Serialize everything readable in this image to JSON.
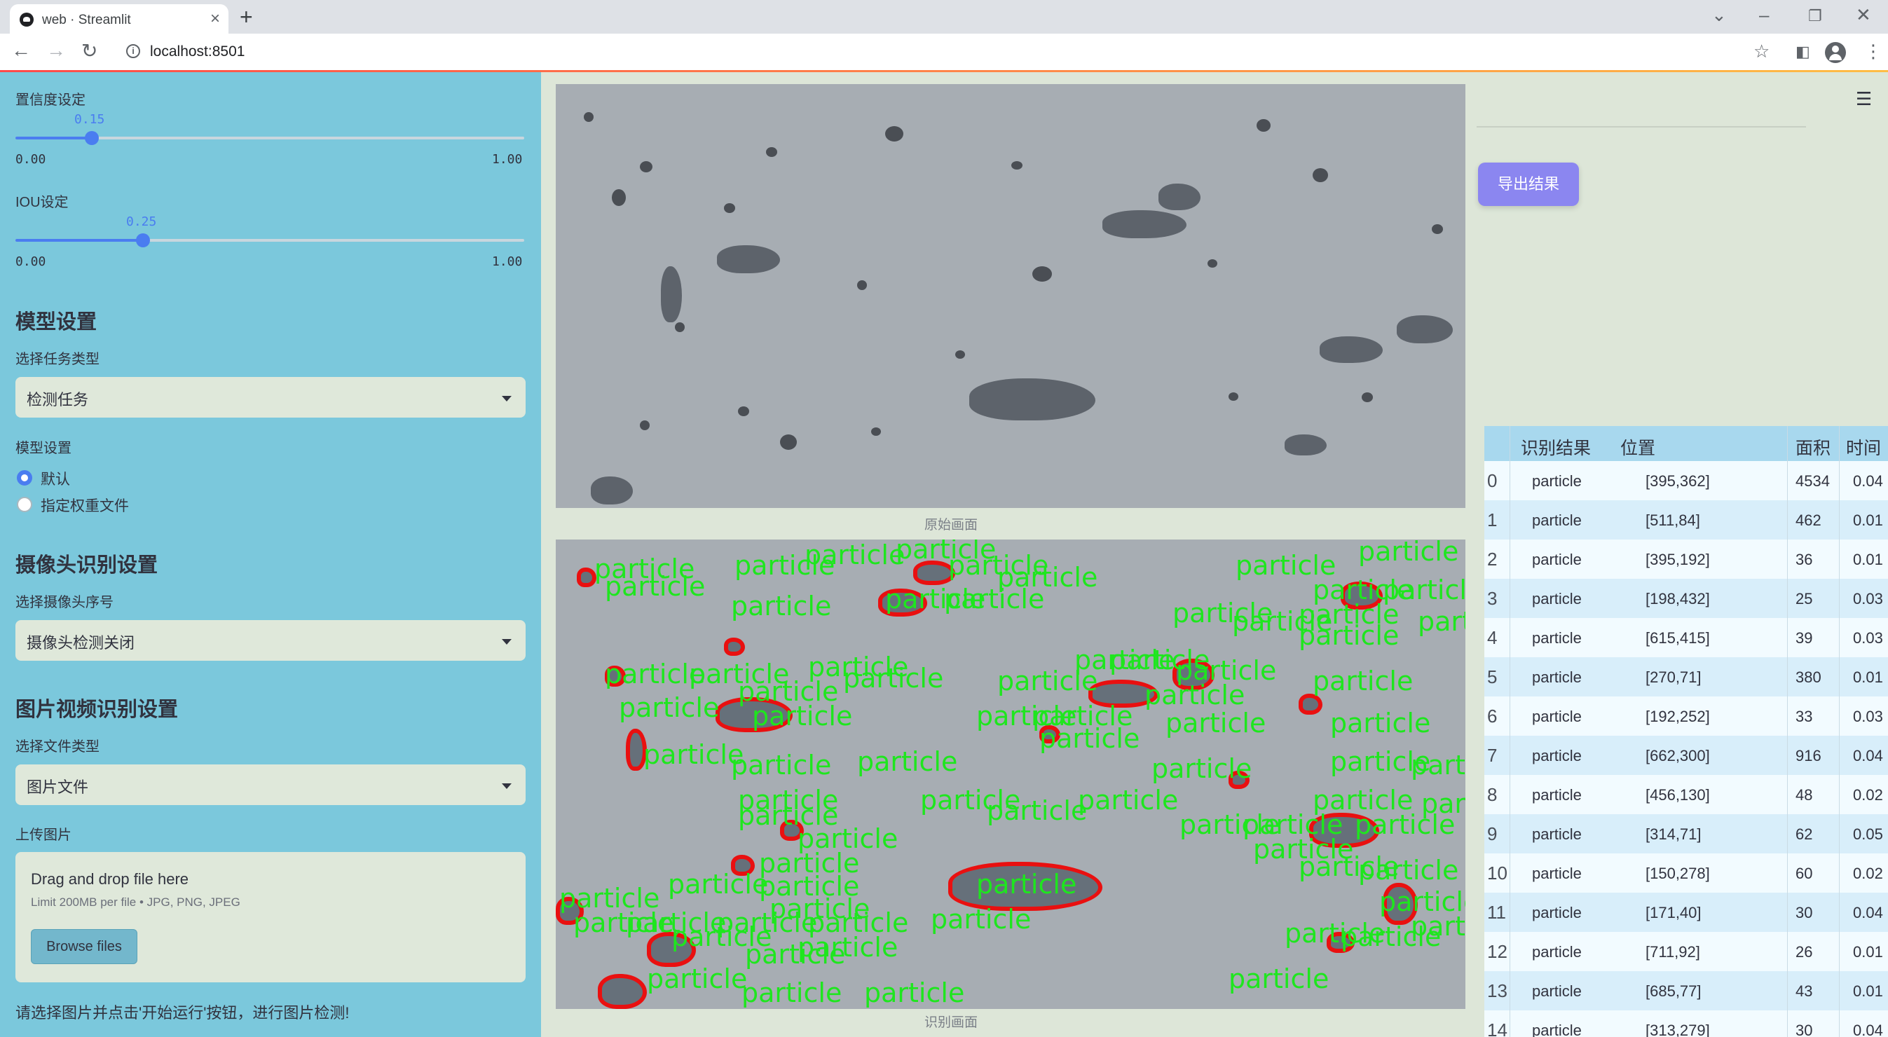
{
  "browser": {
    "tab_title": "web · Streamlit",
    "new_tab": "+",
    "url": "localhost:8501"
  },
  "sidebar": {
    "conf_label": "置信度设定",
    "conf_value": 0.15,
    "conf_value_text": "0.15",
    "conf_min": "0.00",
    "conf_max": "1.00",
    "iou_label": "IOU设定",
    "iou_value": 0.25,
    "iou_value_text": "0.25",
    "iou_min": "0.00",
    "iou_max": "1.00",
    "model_header": "模型设置",
    "task_label": "选择任务类型",
    "task_value": "检测任务",
    "model_label": "模型设置",
    "model_options": [
      "默认",
      "指定权重文件"
    ],
    "model_selected": "默认",
    "camera_header": "摄像头识别设置",
    "camera_label": "选择摄像头序号",
    "camera_value": "摄像头检测关闭",
    "media_header": "图片视频识别设置",
    "filetype_label": "选择文件类型",
    "filetype_value": "图片文件",
    "upload_label": "上传图片",
    "upload_title": "Drag and drop file here",
    "upload_limit": "Limit 200MB per file • JPG, PNG, JPEG",
    "browse_label": "Browse files",
    "hint": "请选择图片并点击'开始运行'按钮，进行图片检测!"
  },
  "main": {
    "orig_caption": "原始画面",
    "det_caption": "识别画面",
    "det_label": "particle",
    "export_label": "导出结果"
  },
  "table": {
    "headers": [
      "识别结果",
      "位置",
      "面积",
      "时间"
    ],
    "rows": [
      {
        "idx": "0",
        "result": "particle",
        "pos": "[395,362]",
        "area": "4534",
        "time": "0.04"
      },
      {
        "idx": "1",
        "result": "particle",
        "pos": "[511,84]",
        "area": "462",
        "time": "0.01"
      },
      {
        "idx": "2",
        "result": "particle",
        "pos": "[395,192]",
        "area": "36",
        "time": "0.01"
      },
      {
        "idx": "3",
        "result": "particle",
        "pos": "[198,432]",
        "area": "25",
        "time": "0.03"
      },
      {
        "idx": "4",
        "result": "particle",
        "pos": "[615,415]",
        "area": "39",
        "time": "0.03"
      },
      {
        "idx": "5",
        "result": "particle",
        "pos": "[270,71]",
        "area": "380",
        "time": "0.01"
      },
      {
        "idx": "6",
        "result": "particle",
        "pos": "[192,252]",
        "area": "33",
        "time": "0.03"
      },
      {
        "idx": "7",
        "result": "particle",
        "pos": "[662,300]",
        "area": "916",
        "time": "0.04"
      },
      {
        "idx": "8",
        "result": "particle",
        "pos": "[456,130]",
        "area": "48",
        "time": "0.02"
      },
      {
        "idx": "9",
        "result": "particle",
        "pos": "[314,71]",
        "area": "62",
        "time": "0.05"
      },
      {
        "idx": "10",
        "result": "particle",
        "pos": "[150,278]",
        "area": "60",
        "time": "0.02"
      },
      {
        "idx": "11",
        "result": "particle",
        "pos": "[171,40]",
        "area": "30",
        "time": "0.04"
      },
      {
        "idx": "12",
        "result": "particle",
        "pos": "[711,92]",
        "area": "26",
        "time": "0.01"
      },
      {
        "idx": "13",
        "result": "particle",
        "pos": "[685,77]",
        "area": "43",
        "time": "0.01"
      },
      {
        "idx": "14",
        "result": "particle",
        "pos": "[313,279]",
        "area": "30",
        "time": "0.04"
      }
    ]
  },
  "colors": {
    "sidebar_bg": "#7bc8dc",
    "accent": "#4a7df0",
    "export_button": "#8b86f0",
    "detect_box": "#e91010",
    "detect_label": "#1ee61e"
  },
  "icons": [
    "streamlit-favicon",
    "close-icon",
    "back-arrow-icon",
    "forward-arrow-icon",
    "reload-icon",
    "info-icon",
    "star-icon",
    "sidepanel-icon",
    "profile-icon",
    "menu-dots-icon",
    "hamburger-icon",
    "chevron-down-icon"
  ]
}
